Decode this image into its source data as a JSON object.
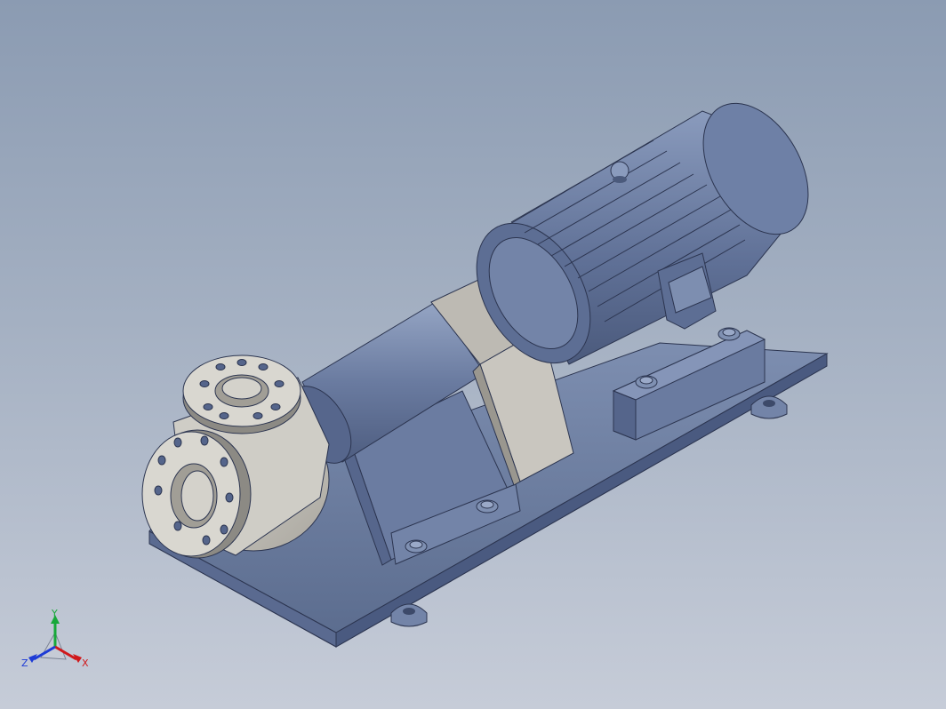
{
  "viewport": {
    "background_top": "#8b9bb2",
    "background_bottom": "#c6ccd8",
    "model_color": "#6d7fa3",
    "casing_color": "#c8c6c0"
  },
  "triad": {
    "x_label": "X",
    "y_label": "Y",
    "z_label": "Z",
    "x_color": "#d0181b",
    "y_color": "#18a83a",
    "z_color": "#1d3bd6"
  }
}
